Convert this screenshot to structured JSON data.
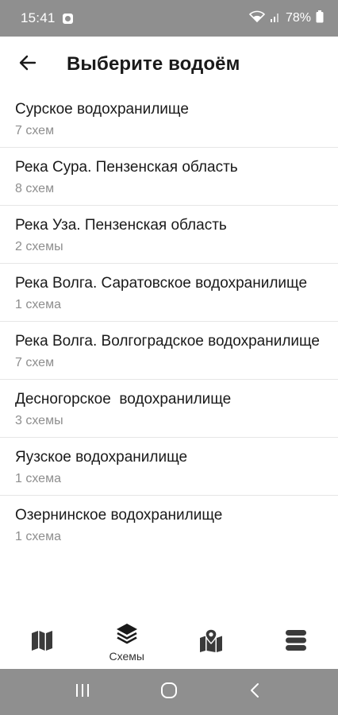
{
  "status_bar": {
    "time": "15:41",
    "battery": "78%"
  },
  "header": {
    "title": "Выберите водоём"
  },
  "list": {
    "items": [
      {
        "title": "Сурское водохранилище",
        "subtitle": "7 схем"
      },
      {
        "title": "Река Сура. Пензенская область",
        "subtitle": "8 схем"
      },
      {
        "title": "Река Уза. Пензенская область",
        "subtitle": "2 схемы"
      },
      {
        "title": "Река Волга. Саратовское водохранилище",
        "subtitle": "1 схема"
      },
      {
        "title": "Река Волга. Волгоградское водохранилище",
        "subtitle": "7 схем"
      },
      {
        "title": "Десногорское  водохранилище",
        "subtitle": "3 схемы"
      },
      {
        "title": "Яузское водохранилище",
        "subtitle": "1 схема"
      },
      {
        "title": "Озернинское водохранилище",
        "subtitle": "1 схема"
      }
    ]
  },
  "bottom_nav": {
    "items": [
      {
        "icon": "map-icon",
        "label": ""
      },
      {
        "icon": "layers-icon",
        "label": "Схемы"
      },
      {
        "icon": "map-pin-icon",
        "label": ""
      },
      {
        "icon": "menu-icon",
        "label": ""
      }
    ],
    "active_index": 1
  },
  "colors": {
    "system_bars": "#8f8f8f",
    "title_text": "#1a1a1a",
    "subtitle_text": "#8e8e8e",
    "icon": "#3a3a3a"
  }
}
